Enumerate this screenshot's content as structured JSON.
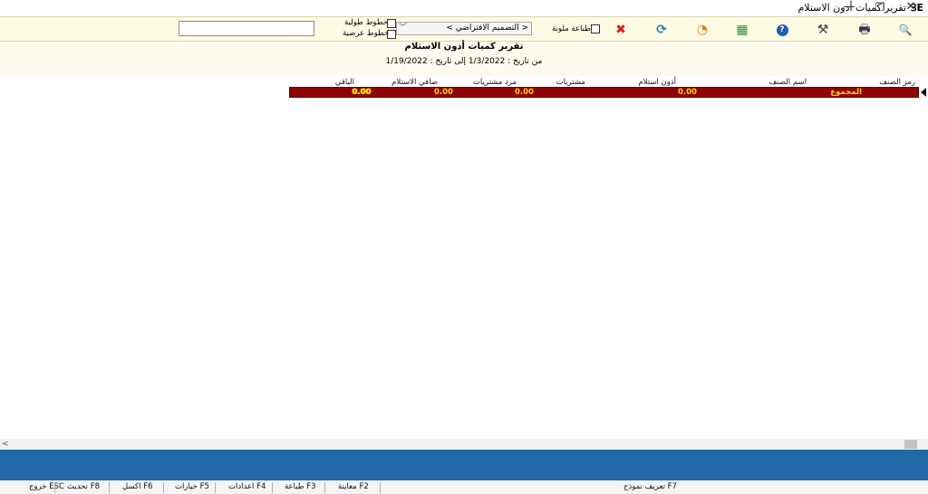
{
  "window": {
    "title": "تقرير كميات أذون الاستلام",
    "minimize": "—",
    "restore": "❐",
    "close": "✕",
    "app_icon": "ꞫE"
  },
  "toolbar": {
    "search_value": "",
    "template_selected": "< التصميم الافتراضي >",
    "color_print_label": "طباعة ملونة",
    "vertical_lines_label": "خطوط طولية",
    "horizontal_lines_label": "خطوط عرضية",
    "icons": {
      "zoom": "🔍",
      "print": "🖶",
      "settings": "⚒",
      "help": "?",
      "excel": "▦",
      "chart": "◔",
      "refresh": "⟳",
      "close": "✖"
    },
    "colors": {
      "close_red": "#d62020",
      "help_blue": "#1e5fb5",
      "refresh_blue": "#2680c2"
    }
  },
  "report": {
    "title": "تقرير كميات أذون الاستلام",
    "date_range": "من تاريخ : 1/3/2022 إلى تاريخ : 1/19/2022"
  },
  "grid": {
    "columns": [
      "رمز الصنف",
      "اسم الصنف",
      "أذون استلام",
      "مشتريات",
      "مرد مشتريات",
      "صافي الاستلام",
      "الباقي"
    ],
    "total_row": {
      "label": "المجموع",
      "receipts": "0.00",
      "purchases": "0.00",
      "purchase_returns": "0.00",
      "net_receipts": "0.00",
      "remaining": "0.00"
    }
  },
  "scrollbar": {
    "left_arrow": "<"
  },
  "function_keys": [
    "ESC خروج",
    "F8 تحديث",
    "F6 اكسل",
    "F5 خيارات",
    "F4 اعدادات",
    "F3 طباعة",
    "F2 معاينة",
    "F7 تعريف نموذج"
  ]
}
